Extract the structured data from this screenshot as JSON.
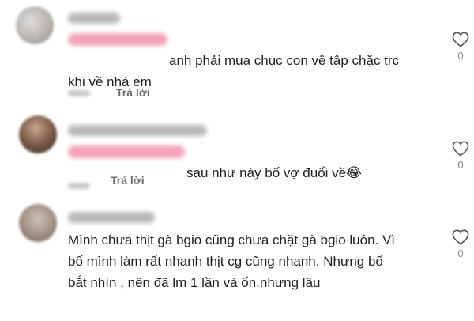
{
  "comments": [
    {
      "text": "anh phải mua chục con về tập chặc trc\nkhi về nhà em",
      "reply_label": "Trả lời",
      "like_count": "0",
      "icons": {
        "like": "heart-outline-icon"
      }
    },
    {
      "text": "sau như này bố vợ đuổi về😂",
      "reply_label": "Trả lời",
      "like_count": "0",
      "icons": {
        "like": "heart-outline-icon"
      }
    },
    {
      "text": "Mình chưa thịt gà bgio cũng chưa chặt gà bgio luôn. Vì\nbố mình làm rất nhanh thịt cg cũng nhanh. Nhưng bố\nbắt nhìn , nên đã lm 1 lần và ổn.nhưng lâu",
      "reply_label": "",
      "like_count": "0",
      "icons": {
        "like": "heart-outline-icon"
      }
    }
  ],
  "colors": {
    "text": "#1f1f1f",
    "reply": "#6b6b6b",
    "like_count": "#8a8a8a",
    "mention_blur": "#f4a3b8",
    "username_blur": "#b9b9b9"
  }
}
